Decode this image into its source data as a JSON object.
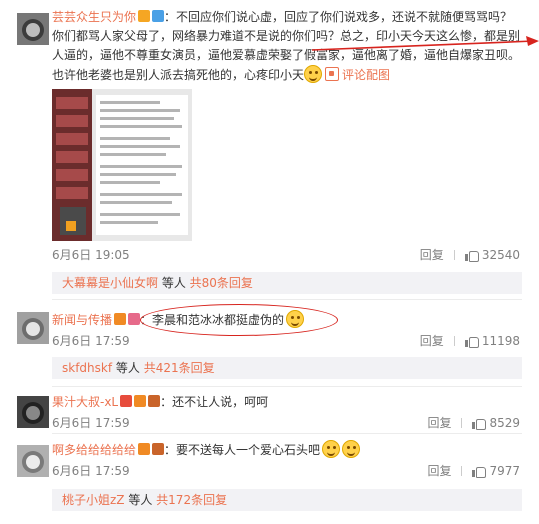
{
  "comments": [
    {
      "username": "芸芸众生只为你",
      "text_lines": [
        "：不回应你们说心虚，回应了你们说戏多，还说不就随便骂骂吗？",
        "你们都骂人家父母了，网络暴力难道不是说的你们吗？总之，印小天今天这么惨，都是别",
        "人逼的，逼他不尊重女演员，逼他爱慕虚荣娶了假富家，逼他离了婚，逼他自爆家丑呗。",
        "也许他老婆也是别人派去搞死他的，心疼印小天"
      ],
      "link_label": "评论配图",
      "time": "6月6日 19:05",
      "reply_label": "回复",
      "likes": "32540",
      "reply_summary": {
        "user": "大幕幕是小仙女啊",
        "mid": " 等人 ",
        "count": "共80条回复"
      }
    },
    {
      "username": "新闻与传播",
      "text": "：李晨和范冰冰都挺虚伪的",
      "time": "6月6日 17:59",
      "reply_label": "回复",
      "likes": "11198",
      "reply_summary": {
        "user": "skfdhskf",
        "mid": " 等人 ",
        "count": "共421条回复"
      }
    },
    {
      "username": "果汁大叔-xL",
      "text": "：还不让人说，呵呵",
      "time": "6月6日 17:59",
      "reply_label": "回复",
      "likes": "8529"
    },
    {
      "username": "啊多给给给给给",
      "text": "：要不送每人一个爱心石头吧",
      "time": "6月6日 17:59",
      "reply_label": "回复",
      "likes": "7977",
      "reply_summary": {
        "user": "桃子小姐zZ",
        "mid": " 等人 ",
        "count": "共172条回复"
      }
    }
  ],
  "colors": {
    "username": "#eb7350",
    "annotation": "#d7241e",
    "reply_box": "#f2f2f5"
  }
}
